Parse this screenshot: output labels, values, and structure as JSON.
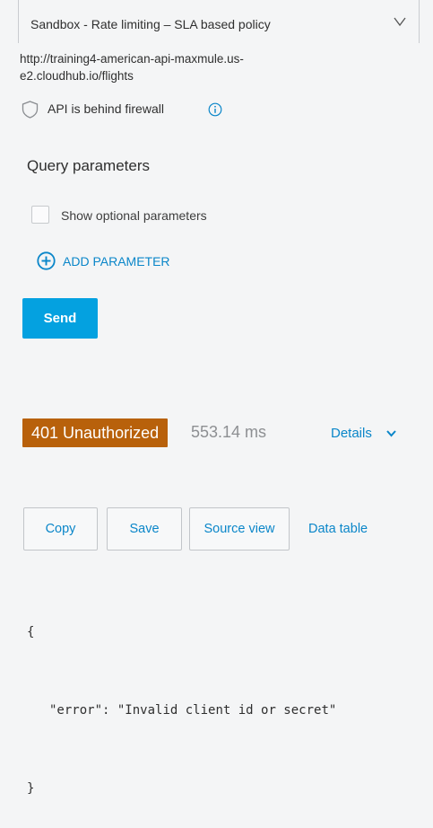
{
  "environment": {
    "selected": "Sandbox - Rate limiting – SLA based policy"
  },
  "endpoint_url": "http://training4-american-api-maxmule.us-e2.cloudhub.io/flights",
  "firewall": {
    "label": "API is behind firewall"
  },
  "query_parameters": {
    "title": "Query parameters",
    "show_optional_label": "Show optional parameters",
    "show_optional_checked": false,
    "add_parameter_label": "ADD PARAMETER"
  },
  "send_label": "Send",
  "response": {
    "status": "401 Unauthorized",
    "elapsed": "553.14 ms",
    "details_label": "Details",
    "toolbar": {
      "copy_label": "Copy",
      "save_label": "Save",
      "source_view_label": "Source view",
      "data_table_label": "Data table"
    },
    "body": {
      "open": "{",
      "key": "\"error\"",
      "sep": ": ",
      "value": "\"Invalid client id or secret\"",
      "close": "}"
    }
  },
  "colors": {
    "accent": "#04a1e0",
    "link": "#0a86c9",
    "status_error": "#b8610b",
    "background": "#f4f5f6"
  }
}
